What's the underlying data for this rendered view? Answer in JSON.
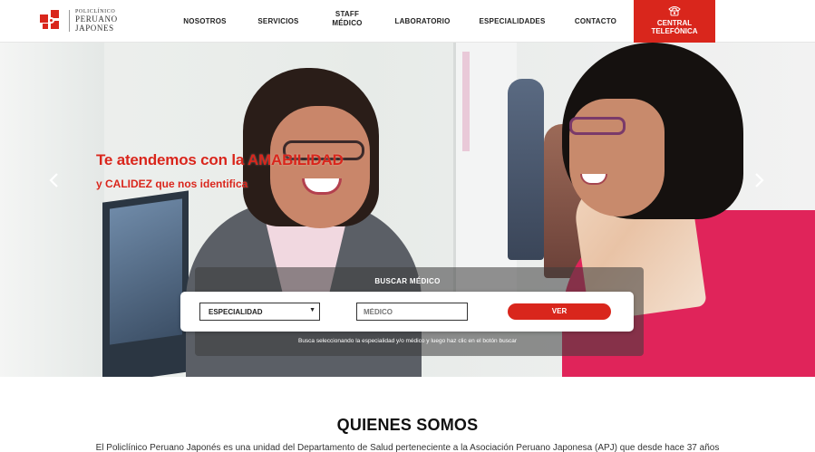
{
  "logo": {
    "line1": "POLICLÍNICO",
    "line2": "PERUANO",
    "line3": "JAPONES",
    "brand_color": "#d9261c"
  },
  "nav": {
    "items": [
      {
        "label": "NOSOTROS"
      },
      {
        "label": "SERVICIOS"
      },
      {
        "label_line1": "STAFF",
        "label_line2": "MÉDICO"
      },
      {
        "label": "LABORATORIO"
      },
      {
        "label": "ESPECIALIDADES"
      },
      {
        "label": "CONTACTO"
      }
    ],
    "central": {
      "line1": "CENTRAL",
      "line2": "TELEFÓNICA",
      "icon": "phone-icon"
    }
  },
  "hero": {
    "headline_prefix": "Te atendemos con la ",
    "headline_emphasis": "AMABILIDAD",
    "subline": "y CALIDEZ que nos identifica",
    "prev_icon": "chevron-left-icon",
    "next_icon": "chevron-right-icon"
  },
  "search": {
    "title": "BUSCAR MÉDICO",
    "specialty_selected": "ESPECIALIDAD",
    "doctor_placeholder": "MÉDICO",
    "button_label": "VER",
    "hint": "Busca seleccionando la especialidad y/o médico y luego haz clic en el botón buscar"
  },
  "about": {
    "title": "QUIENES SOMOS",
    "text": "El Policlínico Peruano Japonés es una unidad del Departamento de Salud perteneciente a la Asociación Peruano Japonesa (APJ) que desde hace 37 años"
  }
}
